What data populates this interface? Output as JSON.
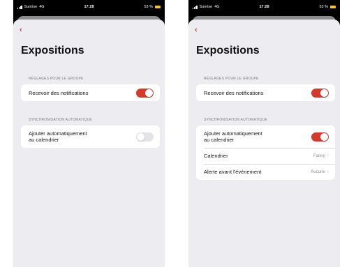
{
  "status_bar": {
    "carrier": "Sunrise",
    "network": "4G",
    "time": "17:28",
    "battery": "53 %"
  },
  "screens": [
    {
      "title": "Expositions",
      "group_section": "RÉGLAGES POUR LE GROUPE",
      "notifications_label": "Recevoir des notifications",
      "notifications_on": true,
      "sync_section": "SYNCHRONISATION AUTOMATIQUE",
      "calendar_line1": "Ajouter automatiquement",
      "calendar_line2": "au calendrier",
      "calendar_on": false
    },
    {
      "title": "Expositions",
      "group_section": "RÉGLAGES POUR LE GROUPE",
      "notifications_label": "Recevoir des notifications",
      "notifications_on": true,
      "sync_section": "SYNCHRONISATION AUTOMATIQUE",
      "calendar_line1": "Ajouter automatiquement",
      "calendar_line2": "au calendrier",
      "calendar_on": true,
      "calendar_select_label": "Calendrier",
      "calendar_select_value": "Fanny",
      "alert_label": "Alerte avant l'événement",
      "alert_value": "Aucune"
    }
  ],
  "colors": {
    "accent": "#d33a2c",
    "background": "#ececf1",
    "toggle_off": "#e3e3e8"
  },
  "icons": {
    "back": "chevron-left-icon",
    "disclosure": "chevron-right-icon",
    "signal": "signal-bars-icon",
    "battery": "battery-icon"
  }
}
